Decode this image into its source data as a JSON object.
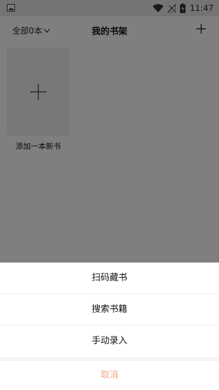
{
  "status_bar": {
    "time": "11:47",
    "icons": [
      "photo-icon",
      "wifi-icon",
      "no-signal-icon",
      "battery-charging-icon"
    ]
  },
  "header": {
    "filter_label": "全部0本",
    "title": "我的书架",
    "add_icon": "plus-icon"
  },
  "shelf": {
    "add_book_label": "添加一本新书"
  },
  "action_sheet": {
    "items": [
      {
        "label": "扫码藏书"
      },
      {
        "label": "搜索书籍"
      },
      {
        "label": "手动录入"
      }
    ],
    "cancel_label": "取消",
    "cancel_color": "#f0a789"
  },
  "colors": {
    "overlay": "#000000",
    "cancel": "#f0a789"
  }
}
